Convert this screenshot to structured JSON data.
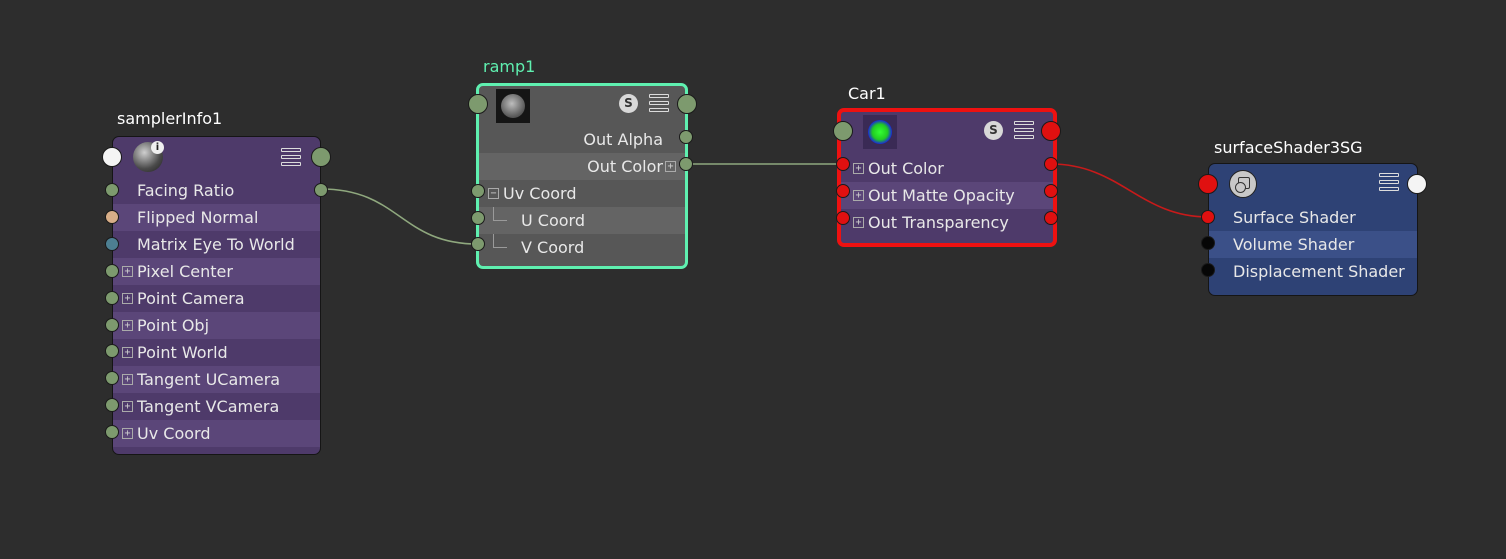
{
  "nodes": {
    "samplerInfo": {
      "title": "samplerInfo1",
      "info_badge": "i",
      "attrs": [
        "Facing Ratio",
        "Flipped Normal",
        "Matrix Eye To World",
        "Pixel Center",
        "Point Camera",
        "Point Obj",
        "Point World",
        "Tangent UCamera",
        "Tangent VCamera",
        "Uv Coord"
      ]
    },
    "ramp": {
      "title": "ramp1",
      "swatch_label": "S",
      "attrs": [
        "Out Alpha",
        "Out Color",
        "Uv Coord",
        "U Coord",
        "V Coord"
      ]
    },
    "car": {
      "title": "Car1",
      "swatch_label": "S",
      "attrs": [
        "Out Color",
        "Out Matte Opacity",
        "Out Transparency"
      ]
    },
    "shadingGroup": {
      "title": "surfaceShader3SG",
      "attrs": [
        "Surface Shader",
        "Volume Shader",
        "Displacement Shader"
      ]
    }
  },
  "colors": {
    "canvas": "#2d2d2d",
    "selected_green": "#5ff0b0",
    "selected_red": "#ee1111",
    "wire_default": "#8fa87e",
    "wire_shader": "#c81a1a"
  },
  "icons": [
    "sampler-sphere-icon",
    "ramp-texture-icon",
    "shader-swatch-icon",
    "shading-group-icon",
    "attribute-menu-icon"
  ]
}
